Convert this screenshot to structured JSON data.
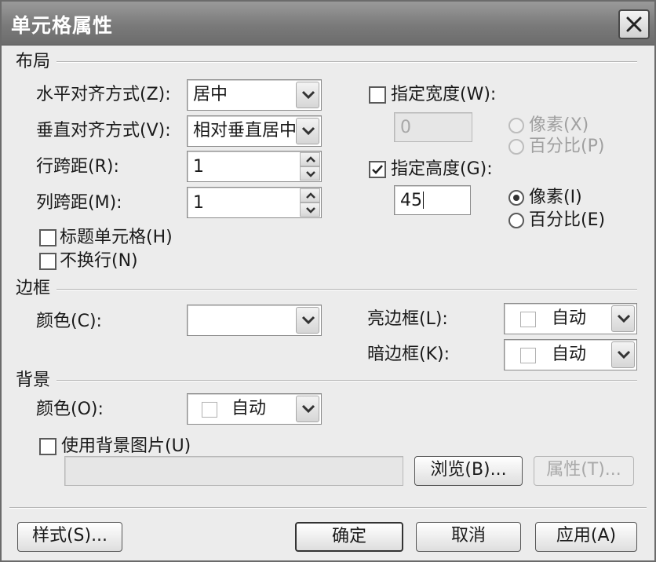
{
  "dialog": {
    "title": "单元格属性"
  },
  "layout_section": {
    "title": "布局",
    "h_align": {
      "label": "水平对齐方式(Z):",
      "value": "居中"
    },
    "v_align": {
      "label": "垂直对齐方式(V):",
      "value": "相对垂直居中"
    },
    "row_span": {
      "label": "行跨距(R):",
      "value": "1"
    },
    "col_span": {
      "label": "列跨距(M):",
      "value": "1"
    },
    "header_cell": {
      "label": "标题单元格(H)",
      "checked": false
    },
    "no_wrap": {
      "label": "不换行(N)",
      "checked": false
    },
    "width": {
      "label": "指定宽度(W):",
      "checked": false,
      "value": "0",
      "pixels_label": "像素(X)",
      "percent_label": "百分比(P)"
    },
    "height": {
      "label": "指定高度(G):",
      "checked": true,
      "value": "45",
      "pixels_label": "像素(I)",
      "percent_label": "百分比(E)",
      "selected": "pixels"
    }
  },
  "border_section": {
    "title": "边框",
    "color": {
      "label": "颜色(C):",
      "value": ""
    },
    "light_border": {
      "label": "亮边框(L):",
      "value": "自动"
    },
    "dark_border": {
      "label": "暗边框(K):",
      "value": "自动"
    }
  },
  "background_section": {
    "title": "背景",
    "color": {
      "label": "颜色(O):",
      "value": "自动"
    },
    "use_image": {
      "label": "使用背景图片(U)",
      "checked": false
    },
    "image_path": "",
    "browse_label": "浏览(B)...",
    "properties_label": "属性(T)..."
  },
  "footer": {
    "style_label": "样式(S)...",
    "ok_label": "确定",
    "cancel_label": "取消",
    "apply_label": "应用(A)"
  }
}
